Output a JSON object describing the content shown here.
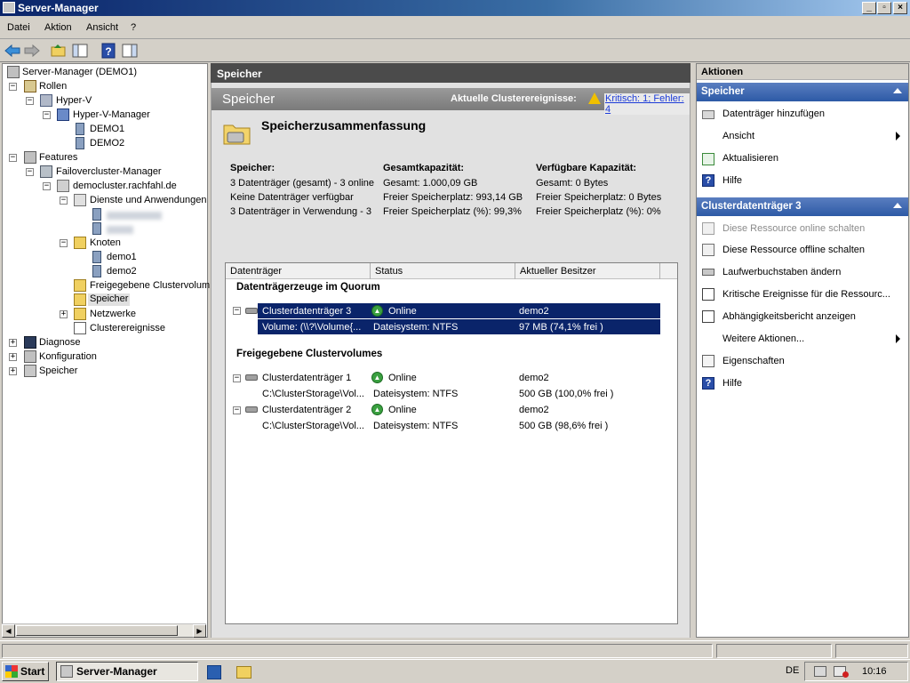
{
  "window": {
    "title": "Server-Manager"
  },
  "menu": [
    "Datei",
    "Aktion",
    "Ansicht",
    "?"
  ],
  "tree": {
    "root": "Server-Manager (DEMO1)",
    "rollen": "Rollen",
    "hyperv": "Hyper-V",
    "hypervmgr": "Hyper-V-Manager",
    "demo1": "DEMO1",
    "demo2": "DEMO2",
    "features": "Features",
    "failover": "Failovercluster-Manager",
    "cluster": "democluster.rachfahl.de",
    "dienste": "Dienste und Anwendungen",
    "knoten": "Knoten",
    "node1": "demo1",
    "node2": "demo2",
    "csv": "Freigegebene Clustervolum",
    "speicher_sel": "Speicher",
    "netzwerke": "Netzwerke",
    "ereignisse": "Clusterereignisse",
    "diagnose": "Diagnose",
    "konfiguration": "Konfiguration",
    "speicher": "Speicher"
  },
  "center": {
    "header": "Speicher",
    "bar_title": "Speicher",
    "events_label": "Aktuelle Clusterereignisse:",
    "events_link": "Kritisch: 1; Fehler: 4",
    "summary_title": "Speicherzusammenfassung",
    "col1_head": "Speicher:",
    "col1": [
      "3 Datenträger (gesamt) - 3 online",
      "Keine Datenträger verfügbar",
      "3 Datenträger in Verwendung - 3"
    ],
    "col2_head": "Gesamtkapazität:",
    "col2": [
      "Gesamt: 1.000,09 GB",
      "Freier Speicherplatz: 993,14 GB",
      "Freier Speicherplatz (%): 99,3%"
    ],
    "col3_head": "Verfügbare Kapazität:",
    "col3": [
      "Gesamt: 0 Bytes",
      "Freier Speicherplatz: 0 Bytes",
      "Freier Speicherplatz (%): 0%"
    ]
  },
  "list": {
    "headers": [
      "Datenträger",
      "Status",
      "Aktueller Besitzer"
    ],
    "group1": "Datenträgerzeuge im Quorum",
    "group2": "Freigegebene Clustervolumes",
    "rows": [
      {
        "name": "Clusterdatenträger 3",
        "status": "Online",
        "owner": "demo2",
        "vol": "Volume: (\\\\?\\Volume{...",
        "fs": "Dateisystem: NTFS",
        "size": "97 MB (74,1% frei )"
      },
      {
        "name": "Clusterdatenträger 1",
        "status": "Online",
        "owner": "demo2",
        "vol": "C:\\ClusterStorage\\Vol...",
        "fs": "Dateisystem: NTFS",
        "size": "500 GB (100,0% frei )"
      },
      {
        "name": "Clusterdatenträger 2",
        "status": "Online",
        "owner": "demo2",
        "vol": "C:\\ClusterStorage\\Vol...",
        "fs": "Dateisystem: NTFS",
        "size": "500 GB (98,6% frei )"
      }
    ]
  },
  "actions": {
    "header": "Aktionen",
    "section1": "Speicher",
    "s1": [
      "Datenträger hinzufügen",
      "Ansicht",
      "Aktualisieren",
      "Hilfe"
    ],
    "section2": "Clusterdatenträger 3",
    "s2": [
      "Diese Ressource online schalten",
      "Diese Ressource offline schalten",
      "Laufwerbuchstaben ändern",
      "Kritische Ereignisse für die Ressourc...",
      "Abhängigkeitsbericht anzeigen",
      "Weitere Aktionen...",
      "Eigenschaften",
      "Hilfe"
    ]
  },
  "taskbar": {
    "start": "Start",
    "item": "Server-Manager",
    "lang": "DE",
    "clock": "10:16"
  }
}
